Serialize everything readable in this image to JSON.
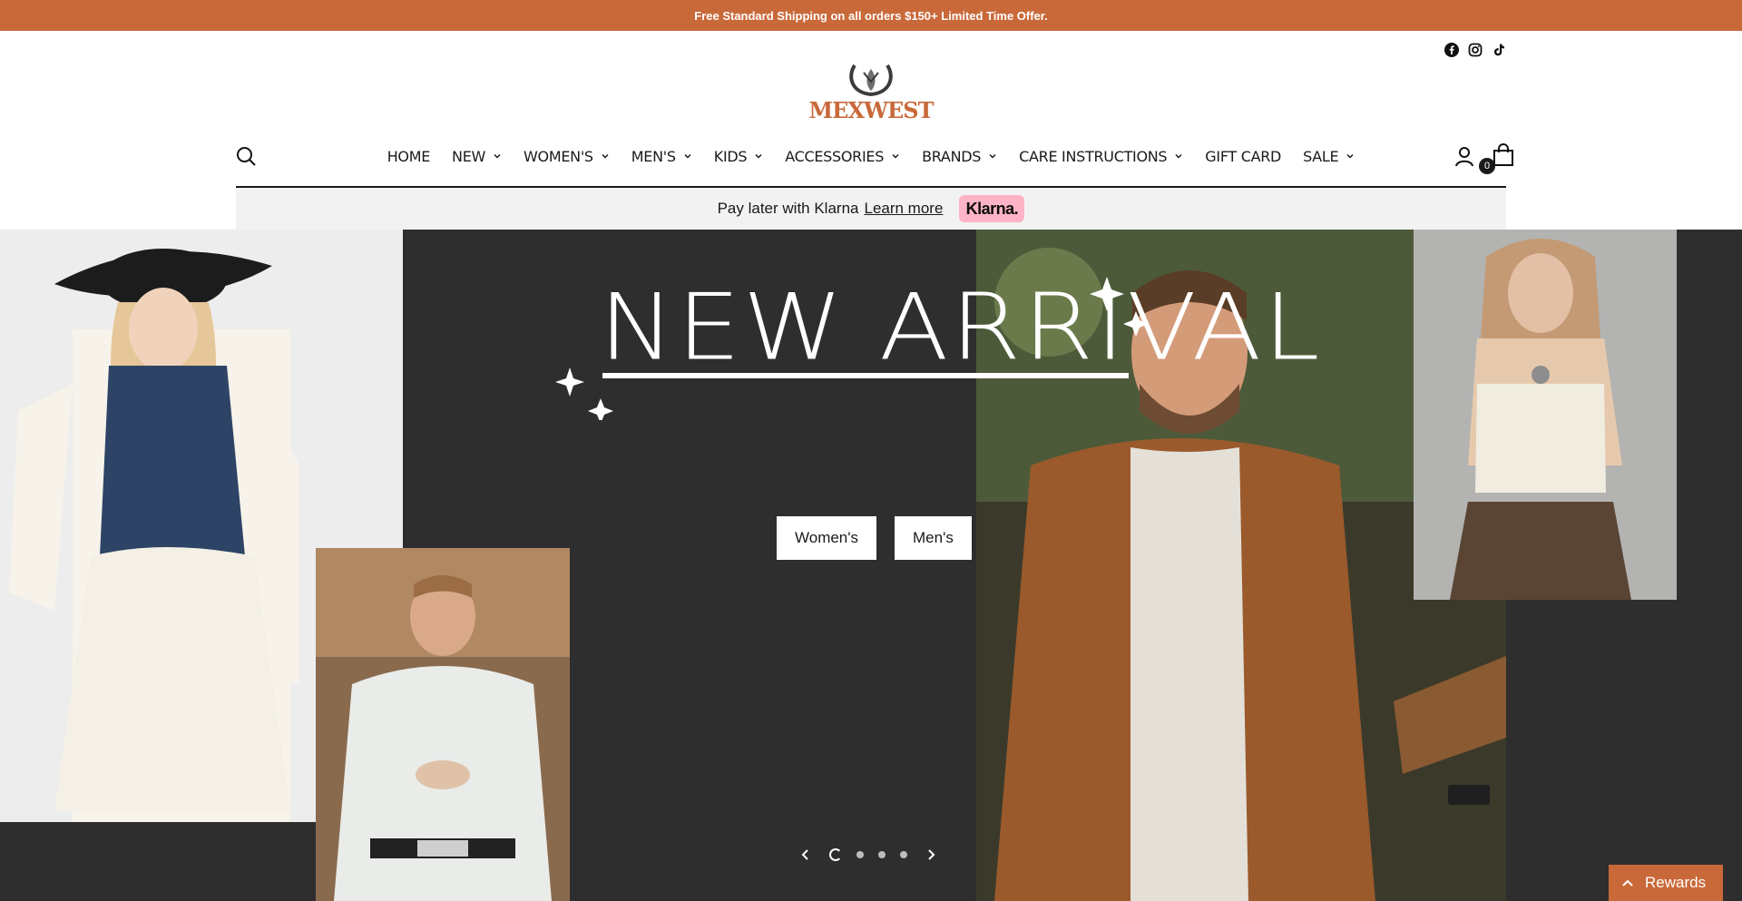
{
  "announcement": {
    "text": "Free Standard Shipping on all orders $150+ Limited Time Offer."
  },
  "socials": [
    {
      "icon": "facebook-icon"
    },
    {
      "icon": "instagram-icon"
    },
    {
      "icon": "tiktok-icon"
    }
  ],
  "logo": {
    "text": "MEXWEST"
  },
  "nav": {
    "items": [
      {
        "label": "HOME",
        "has_dropdown": false
      },
      {
        "label": "NEW",
        "has_dropdown": true
      },
      {
        "label": "WOMEN'S",
        "has_dropdown": true
      },
      {
        "label": "MEN'S",
        "has_dropdown": true
      },
      {
        "label": "KIDS",
        "has_dropdown": true
      },
      {
        "label": "ACCESSORIES",
        "has_dropdown": true
      },
      {
        "label": "BRANDS",
        "has_dropdown": true
      },
      {
        "label": "CARE INSTRUCTIONS",
        "has_dropdown": true
      },
      {
        "label": "GIFT CARD",
        "has_dropdown": false
      },
      {
        "label": "SALE",
        "has_dropdown": true
      }
    ],
    "cart_count": "0"
  },
  "klarna": {
    "text": "Pay later with Klarna",
    "link": "Learn more",
    "badge": "Klarna."
  },
  "hero": {
    "title": "NEW ARRIVAL",
    "buttons": [
      {
        "label": "Women's"
      },
      {
        "label": "Men's"
      }
    ],
    "slides": 4,
    "active_slide": 1
  },
  "rewards": {
    "label": "Rewards"
  },
  "colors": {
    "brand": "#c9693a",
    "klarna_pink": "#ffb3c7",
    "hero_bg": "#2e2e2e"
  }
}
